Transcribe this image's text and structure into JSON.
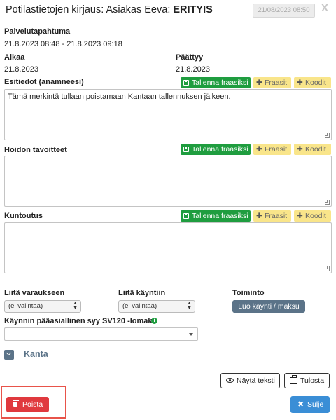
{
  "header": {
    "title_prefix": "Potilastietojen kirjaus: Asiakas Eeva: ",
    "title_strong": "ERITYIS",
    "date_value": "21/08/2023  08:50",
    "close_label": "X"
  },
  "event": {
    "label": "Palvelutapahtuma",
    "value": "21.8.2023 08:48 - 21.8.2023 09:18",
    "start_label": "Alkaa",
    "start_value": "21.8.2023",
    "end_label": "Päättyy",
    "end_value": "21.8.2023"
  },
  "buttons": {
    "save_phrase": "Tallenna fraasiksi",
    "phrases": "Fraasit",
    "codes": "Koodit"
  },
  "sections": [
    {
      "label": "Esitiedot (anamneesi)",
      "text": "Tämä merkintä tullaan poistamaan Kantaan tallennuksen jälkeen."
    },
    {
      "label": "Hoidon tavoitteet",
      "text": ""
    },
    {
      "label": "Kuntoutus",
      "text": ""
    }
  ],
  "links": {
    "booking_label": "Liitä varaukseen",
    "booking_value": "(ei valintaa)",
    "visit_label": "Liitä käyntiin",
    "visit_value": "(ei valintaa)",
    "action_label": "Toiminto",
    "action_button": "Luo käynti / maksu",
    "reason_label": "Käynnin pääasiallinen syy SV120 -lomake",
    "reason_value": ""
  },
  "kanta": {
    "label": "Kanta"
  },
  "footer": {
    "show_text": "Näytä teksti",
    "print": "Tulosta",
    "delete": "Poista",
    "close": "Sulje"
  },
  "colors": {
    "green": "#1f9d3f",
    "yellow": "#f9e58a",
    "slate": "#5b7388",
    "red": "#e0393e",
    "blue": "#3a8ed6"
  }
}
